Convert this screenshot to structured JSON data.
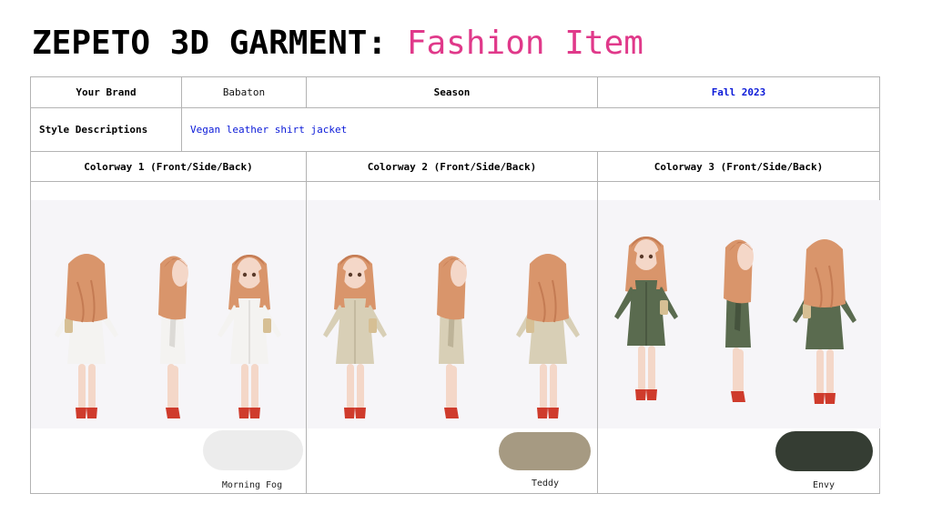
{
  "title": {
    "main": "ZEPETO 3D GARMENT:",
    "accent": "Fashion Item"
  },
  "table": {
    "brand_label": "Your Brand",
    "brand_value": "Babaton",
    "season_label": "Season",
    "season_value": "Fall 2023",
    "style_label": "Style Descriptions",
    "style_value": "Vegan leather shirt jacket",
    "colorways": [
      {
        "header": "Colorway 1 (Front/Side/Back)",
        "swatch_name": "Morning Fog",
        "color": "#ececec",
        "garment": "#f4f3f1",
        "garment_shade": "#dcdad6"
      },
      {
        "header": "Colorway 2 (Front/Side/Back)",
        "swatch_name": "Teddy",
        "color": "#a69a82",
        "garment": "#d8cfb6",
        "garment_shade": "#bdb398"
      },
      {
        "header": "Colorway 3 (Front/Side/Back)",
        "swatch_name": "Envy",
        "color": "#353d33",
        "garment": "#5a6b4f",
        "garment_shade": "#45533d"
      }
    ]
  },
  "avatar": {
    "hair": "#d9956b",
    "hair_shade": "#c47b53",
    "skin": "#f4d7c8",
    "shoe": "#cf3b2c",
    "bag": "#d6bf94"
  }
}
